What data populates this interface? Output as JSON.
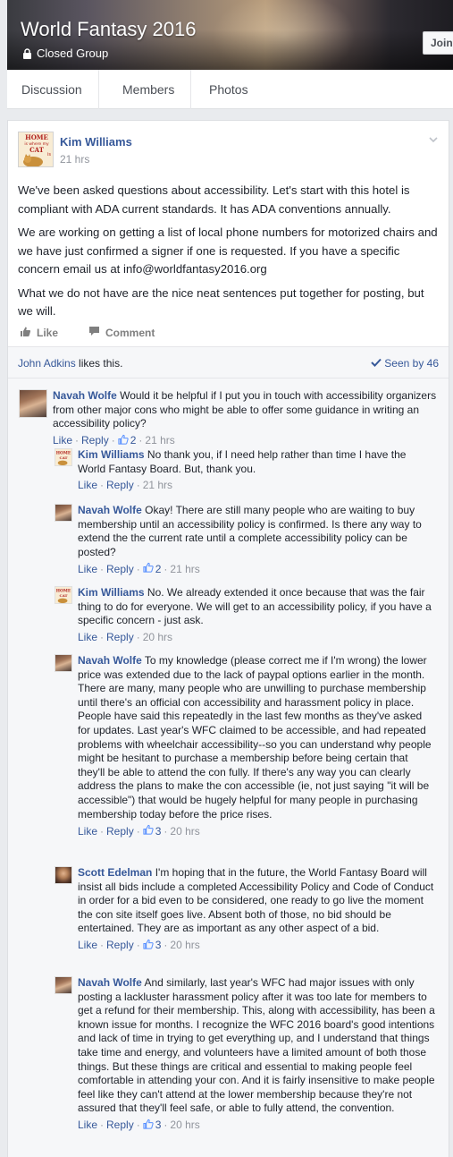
{
  "group": {
    "title": "World Fantasy 2016",
    "privacy": "Closed Group",
    "join_label": "Join"
  },
  "tabs": [
    "Discussion",
    "Members",
    "Photos"
  ],
  "post": {
    "author": "Kim Williams",
    "time": "21 hrs",
    "avatar_text": [
      "HOME",
      "is where my",
      "CAT",
      "is"
    ],
    "paragraphs": [
      "We've been asked questions about accessibility. Let's start with this hotel is compliant with ADA current standards. It has ADA conventions annually.",
      "We are working on getting a list of local phone numbers for motorized chairs and we have just confirmed a signer if one is requested. If you have a specific concern email us at info@worldfantasy2016.org",
      "What we do not have are the nice neat sentences put together for posting, but we will."
    ],
    "like_label": "Like",
    "comment_label": "Comment",
    "liker": "John Adkins",
    "likes_suffix": " likes this.",
    "seen_label": "Seen by 46"
  },
  "comments": [
    {
      "author": "Navah Wolfe",
      "avatar": "navah",
      "text": "Would it be helpful if I put you in touch with accessibility organizers from other major cons who might be able to offer some guidance in writing an accessibility policy?",
      "like": "Like",
      "reply": "Reply",
      "likes": "2",
      "time": "21 hrs"
    },
    {
      "author": "Kim Williams",
      "avatar": "kim",
      "text": "No thank you, if I need help rather than time I have the World Fantasy Board. But, thank you.",
      "like": "Like",
      "reply": "Reply",
      "likes": "",
      "time": "21 hrs"
    },
    {
      "author": "Navah Wolfe",
      "avatar": "navah",
      "text": "Okay! There are still many people who are waiting to buy membership until an accessibility policy is confirmed. Is there any way to extend the the current rate until a complete accessibility policy can be posted?",
      "like": "Like",
      "reply": "Reply",
      "likes": "2",
      "time": "21 hrs"
    },
    {
      "author": "Kim Williams",
      "avatar": "kim",
      "text": "No. We already extended it once because that was the fair thing to do for everyone. We will get to an accessibility policy, if you have a specific concern - just ask.",
      "like": "Like",
      "reply": "Reply",
      "likes": "",
      "time": "20 hrs"
    },
    {
      "author": "Navah Wolfe",
      "avatar": "navah",
      "text": "To my knowledge (please correct me if I'm wrong) the lower price was extended due to the lack of paypal options earlier in the month. There are many, many people who are unwilling to purchase membership until there's an official con accessibility and harassment policy in place. People have said this repeatedly in the last few months as they've asked for updates. Last year's WFC claimed to be accessible, and had repeated problems with wheelchair accessibility--so you can understand why people might be hesitant to purchase a membership before being certain that they'll be able to attend the con fully. If there's any way you can clearly address the plans to make the con accessible (ie, not just saying \"it will be accessible\") that would be hugely helpful for many people in purchasing membership today before the price rises.",
      "like": "Like",
      "reply": "Reply",
      "likes": "3",
      "time": "20 hrs"
    },
    {
      "author": "Scott Edelman",
      "avatar": "scott",
      "text": "I'm hoping that in the future, the World Fantasy Board will insist all bids include a completed Accessibility Policy and Code of Conduct in order for a bid even to be considered, one ready to go live the moment the con site itself goes live. Absent both of those, no bid should be entertained. They are as important as any other aspect of a bid.",
      "like": "Like",
      "reply": "Reply",
      "likes": "3",
      "time": "20 hrs"
    },
    {
      "author": "Navah Wolfe",
      "avatar": "navah",
      "text": "And similarly, last year's WFC had major issues with only posting a lackluster harassment policy after it was too late for members to get a refund for their membership. This, along with accessibility, has been a known issue for months. I recognize the WFC 2016 board's good intentions and lack of time in trying to get everything up, and I understand that things take time and energy, and volunteers have a limited amount of both those things. But these things are critical and essential to making people feel comfortable in attending your con. And it is fairly insensitive to make people feel like they can't attend at the lower membership because they're not assured that they'll feel safe, or able to fully attend, the convention.",
      "like": "Like",
      "reply": "Reply",
      "likes": "3",
      "time": "20 hrs"
    }
  ]
}
